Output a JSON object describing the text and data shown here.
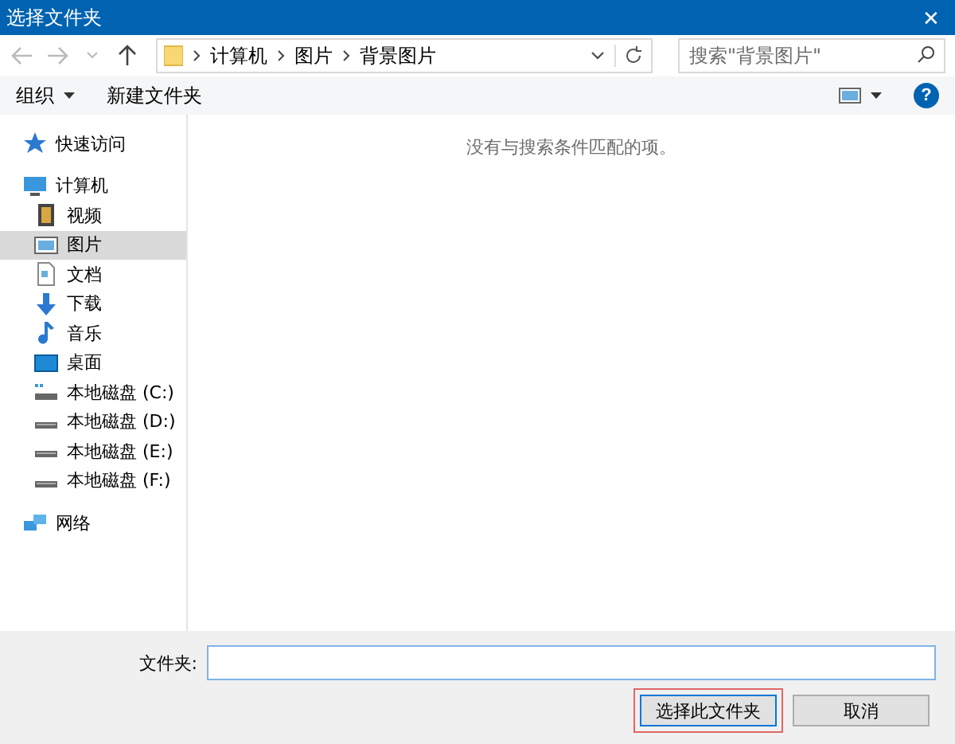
{
  "window": {
    "title": "选择文件夹",
    "close": "✕"
  },
  "breadcrumb": [
    "计算机",
    "图片",
    "背景图片"
  ],
  "search": {
    "placeholder": "搜索\"背景图片\""
  },
  "toolbar": {
    "organize": "组织",
    "new_folder": "新建文件夹",
    "help": "?"
  },
  "sidebar": {
    "items": [
      {
        "label": "快速访问",
        "kind": "star",
        "selected": false
      },
      {
        "label": "计算机",
        "kind": "computer",
        "selected": false,
        "children": [
          {
            "label": "视频",
            "kind": "video",
            "selected": false
          },
          {
            "label": "图片",
            "kind": "picture",
            "selected": true
          },
          {
            "label": "文档",
            "kind": "document",
            "selected": false
          },
          {
            "label": "下载",
            "kind": "download",
            "selected": false
          },
          {
            "label": "音乐",
            "kind": "music",
            "selected": false
          },
          {
            "label": "桌面",
            "kind": "desktop",
            "selected": false
          },
          {
            "label": "本地磁盘 (C:)",
            "kind": "systemdisk",
            "selected": false
          },
          {
            "label": "本地磁盘 (D:)",
            "kind": "disk",
            "selected": false
          },
          {
            "label": "本地磁盘 (E:)",
            "kind": "disk",
            "selected": false
          },
          {
            "label": "本地磁盘 (F:)",
            "kind": "disk",
            "selected": false
          }
        ]
      },
      {
        "label": "网络",
        "kind": "network",
        "selected": false
      }
    ]
  },
  "content": {
    "empty_message": "没有与搜索条件匹配的项。"
  },
  "footer": {
    "folder_label": "文件夹:",
    "buttons": [
      {
        "label": "选择此文件夹",
        "kind": "primary",
        "highlighted": true
      },
      {
        "label": "取消",
        "kind": "normal",
        "highlighted": false
      }
    ]
  }
}
